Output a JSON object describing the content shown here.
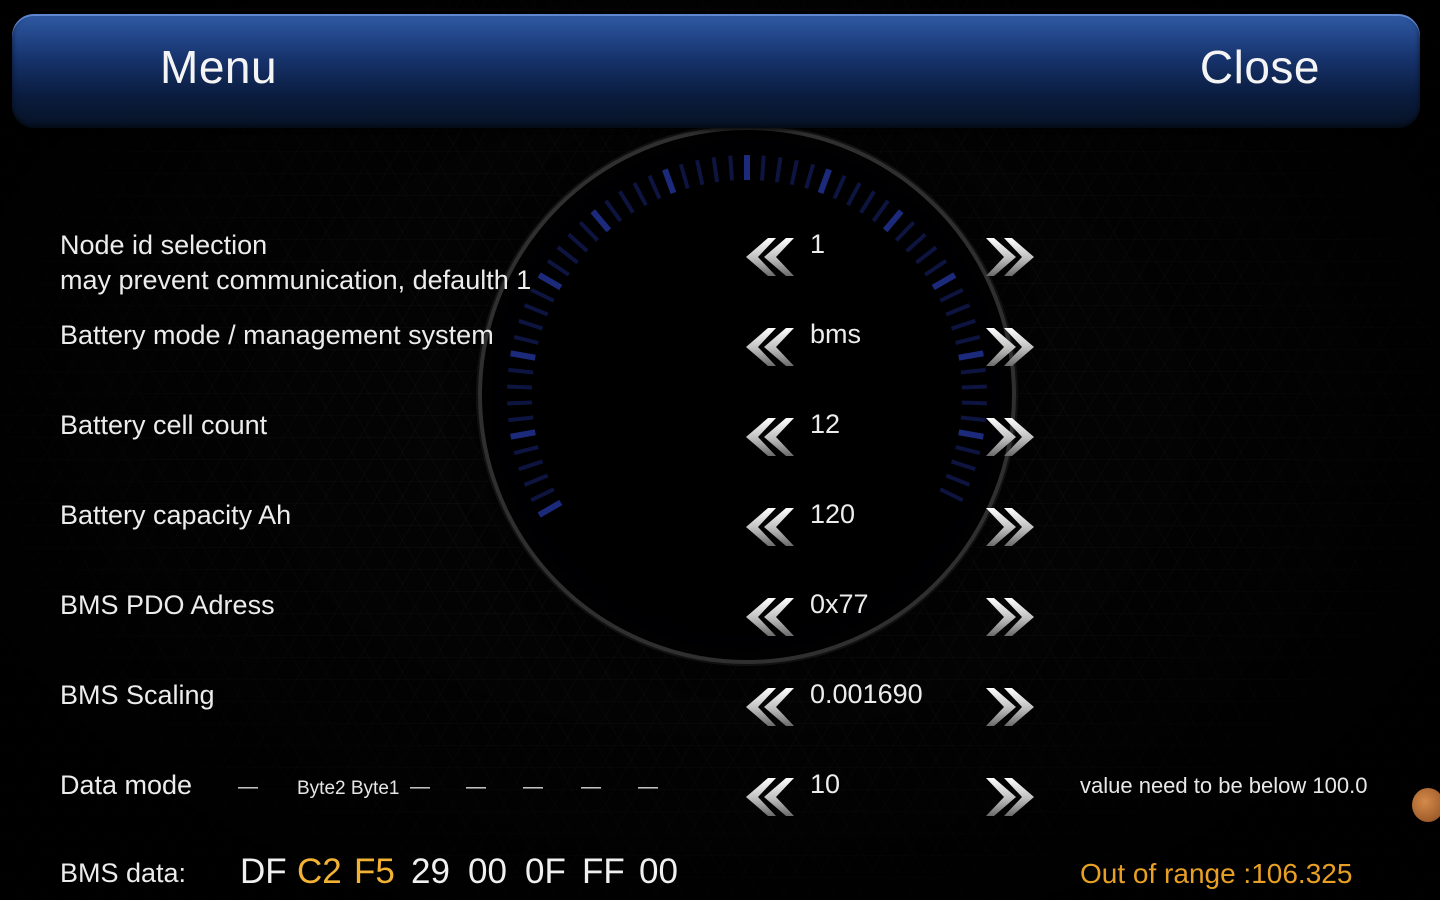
{
  "header": {
    "menu_label": "Menu",
    "close_label": "Close"
  },
  "rows": [
    {
      "label_line1": "Node id selection",
      "label_line2": "may prevent communication, defaulth 1",
      "value": "1"
    },
    {
      "label": "Battery mode / management system",
      "value": "bms"
    },
    {
      "label": "Battery cell count",
      "value": "12"
    },
    {
      "label": "Battery capacity Ah",
      "value": "120"
    },
    {
      "label": "BMS PDO Adress",
      "value": "0x77"
    },
    {
      "label": "BMS Scaling",
      "value": "0.001690"
    },
    {
      "label": "Data mode",
      "value": "10",
      "byte_labels": "Byte2 Byte1",
      "dash": "—",
      "hint": "value need to be below 100.0"
    }
  ],
  "bms": {
    "label": "BMS data:",
    "bytes": [
      "DF",
      "C2",
      "F5",
      "29",
      "00",
      "0F",
      "FF",
      "00"
    ],
    "highlight_color": "#f2b233",
    "out_of_range": "Out of range :106.325",
    "out_of_range_color": "#e8a024"
  },
  "icons": {
    "decrease": "double-chevron-left-icon",
    "increase": "double-chevron-right-icon"
  }
}
